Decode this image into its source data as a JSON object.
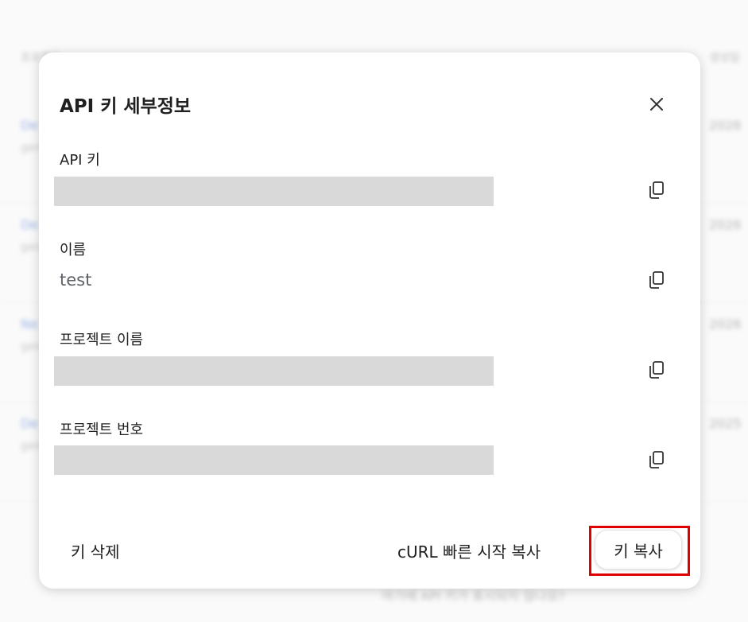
{
  "background": {
    "header_left": "프로젝트",
    "header_right": "생성일",
    "rows": [
      {
        "name": "De",
        "sub": "gen",
        "date": "2026"
      },
      {
        "name": "De",
        "sub": "gen",
        "date": "2026"
      },
      {
        "name": "Ne",
        "sub": "gen",
        "date": "2026"
      },
      {
        "name": "De",
        "sub": "gen",
        "date": "2025"
      }
    ],
    "bottom_link": "여기에 API 키가 표시되지 않나요?"
  },
  "dialog": {
    "title": "API 키 세부정보",
    "close_icon": "close-icon",
    "fields": [
      {
        "label": "API 키",
        "value": "",
        "redacted": true
      },
      {
        "label": "이름",
        "value": "test",
        "redacted": false
      },
      {
        "label": "프로젝트 이름",
        "value": "",
        "redacted": true
      },
      {
        "label": "프로젝트 번호",
        "value": "",
        "redacted": true
      }
    ],
    "copy_icon": "copy-icon",
    "footer": {
      "delete_label": "키 삭제",
      "curl_label": "cURL 빠른 시작 복사",
      "copy_key_label": "키 복사"
    }
  },
  "colors": {
    "highlight": "#e00000",
    "redacted": "#d9d9d9"
  }
}
